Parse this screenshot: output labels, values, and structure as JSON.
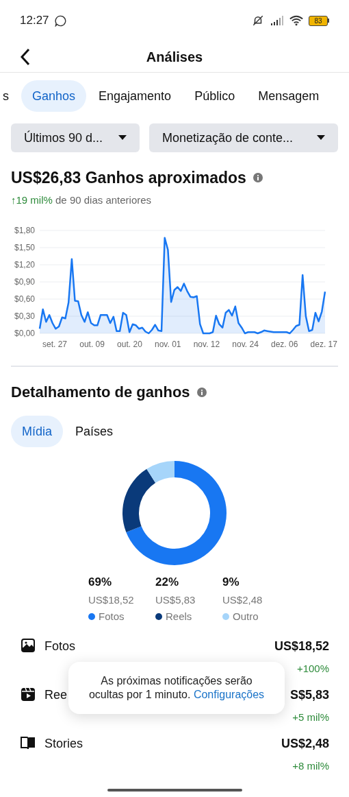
{
  "status_bar": {
    "time": "12:27",
    "battery": "83"
  },
  "header": {
    "title": "Análises"
  },
  "tabs": [
    {
      "label": "s",
      "selected": false
    },
    {
      "label": "Ganhos",
      "selected": true
    },
    {
      "label": "Engajamento",
      "selected": false
    },
    {
      "label": "Público",
      "selected": false
    },
    {
      "label": "Mensagem",
      "selected": false
    }
  ],
  "filters": [
    {
      "value": "Últimos 90 d..."
    },
    {
      "value": "Monetização de conte..."
    }
  ],
  "summary": {
    "amount": "US$26,83",
    "label": "Ganhos aproximados",
    "change": "↑19 mil%",
    "change_text": "de 90 dias anteriores"
  },
  "chart_data": {
    "type": "area",
    "grid": true,
    "ylim": [
      0,
      1.8
    ],
    "yticks": [
      {
        "value": 0,
        "label": "$0,00"
      },
      {
        "value": 0.3,
        "label": "$0,30"
      },
      {
        "value": 0.6,
        "label": "$0,60"
      },
      {
        "value": 0.9,
        "label": "$0,90"
      },
      {
        "value": 1.2,
        "label": "$1,20"
      },
      {
        "value": 1.5,
        "label": "$1,50"
      },
      {
        "value": 1.8,
        "label": "$1,80"
      }
    ],
    "series": [
      {
        "color": "#1877f2",
        "values": [
          0.08,
          0.42,
          0.2,
          0.32,
          0.18,
          0.08,
          0.12,
          0.28,
          0.26,
          0.54,
          1.3,
          0.57,
          0.56,
          0.32,
          0.2,
          0.37,
          0.18,
          0.14,
          0.14,
          0.32,
          0.32,
          0.32,
          0.18,
          0.29,
          0.04,
          0.04,
          0.36,
          0.32,
          0.02,
          0.16,
          0.14,
          0.08,
          0.1,
          0.03,
          0,
          0.06,
          0.15,
          0.05,
          0.04,
          1.67,
          1.46,
          0.55,
          0.76,
          0.81,
          0.74,
          0.87,
          0.74,
          0.64,
          0.63,
          0.65,
          0.16,
          0,
          0,
          0,
          0.02,
          0.31,
          0.16,
          0.1,
          0.36,
          0.41,
          0.31,
          0.47,
          0.18,
          0.1,
          0,
          0.02,
          0.02,
          0.02,
          0,
          0.02,
          0.05,
          0.04,
          0.03,
          0.02,
          0.02,
          0.02,
          0.02,
          0.02,
          0,
          0.06,
          0.13,
          0.15,
          1.02,
          0.3,
          0.04,
          0.06,
          0.36,
          0.21,
          0.38,
          0.73
        ]
      }
    ]
  },
  "x_axis_labels": [
    "set. 27",
    "out. 09",
    "out. 20",
    "nov. 01",
    "nov. 12",
    "nov. 24",
    "dez. 06",
    "dez. 17"
  ],
  "breakdown": {
    "title": "Detalhamento de ganhos",
    "tabs": [
      {
        "label": "Mídia",
        "selected": true
      },
      {
        "label": "Países",
        "selected": false
      }
    ],
    "chart_data": {
      "type": "donut",
      "categories": [
        "Fotos",
        "Reels",
        "Outro"
      ],
      "values": [
        69,
        22,
        9
      ]
    },
    "legend": [
      {
        "percent": "69%",
        "amount": "US$18,52",
        "color": "#1877f2"
      },
      {
        "percent": "22%",
        "amount": "US$5,83",
        "color": "#0a3a7a"
      },
      {
        "percent": "9%",
        "amount": "US$2,48",
        "color": "#a6d5fa"
      }
    ],
    "rows": [
      {
        "kind": "photo",
        "label": "Fotos",
        "amount": "US$18,52",
        "change": "+100%"
      },
      {
        "kind": "reel",
        "label": "Ree",
        "amount": "S$5,83",
        "change": "+5 mil%"
      },
      {
        "kind": "story",
        "label": "Stories",
        "amount": "US$2,48",
        "change": "+8 mil%"
      }
    ]
  },
  "toast": {
    "text": "As próximas notificações serão ocultas por 1 minuto.",
    "link": "Configurações"
  }
}
